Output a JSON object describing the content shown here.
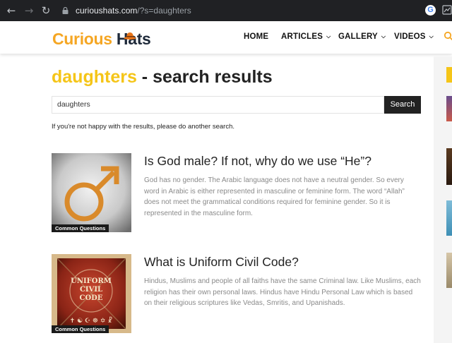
{
  "browser": {
    "url_domain": "curioushats.com",
    "url_path": "/?s=daughters",
    "back_icon": "arrow-left-icon",
    "forward_icon": "arrow-right-icon",
    "reload_icon": "reload-icon",
    "lock_icon": "lock-icon",
    "google_badge": "G",
    "extension_icon": "extension-icon"
  },
  "site": {
    "logo_word1": "Curious",
    "logo_word2": "Hats",
    "colors": {
      "brand_orange": "#f5a623",
      "brand_navy": "#1f2a3a",
      "accent_yellow": "#f5c518"
    },
    "menu": [
      {
        "label": "HOME",
        "has_dropdown": false
      },
      {
        "label": "ARTICLES",
        "has_dropdown": true
      },
      {
        "label": "GALLERY",
        "has_dropdown": true
      },
      {
        "label": "VIDEOS",
        "has_dropdown": true
      }
    ],
    "search_icon": "search-icon"
  },
  "page": {
    "query_term": "daughters",
    "heading_suffix": " - search results",
    "search_input_value": "daughters",
    "search_button_label": "Search",
    "notice": "If you're not happy with the results, please do another search."
  },
  "results": [
    {
      "title": "Is God male? If not, why do we use “He”?",
      "category": "Common Questions",
      "excerpt": "God has no gender. The Arabic language does not have a neutral gender. So every word in Arabic is either represented in masculine or feminine form. The word “Allah” does not meet the grammatical conditions required for feminine gender. So it is represented in the masculine form."
    },
    {
      "title": "What is Uniform Civil Code?",
      "category": "Common Questions",
      "thumb_text_1": "UNIFORM",
      "thumb_text_2": "CIVIL",
      "thumb_text_3": "CODE",
      "excerpt": "Hindus, Muslims and people of all faiths have the same Criminal law. Like Muslims, each religion has their own personal laws. Hindus have Hindu Personal Law which is based on their religious scriptures like Vedas, Smritis, and Upanishads."
    }
  ]
}
